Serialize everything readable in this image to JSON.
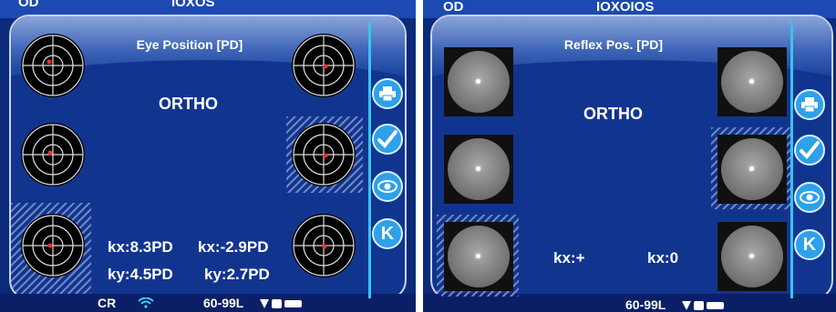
{
  "left": {
    "topbar": {
      "eye_left": "OD",
      "eye_right": "IOXOS"
    },
    "dialog_title": "Eye Position [PD]",
    "status": "ORTHO",
    "measurements": {
      "kx_left": "kx:8.3PD",
      "kx_right": "kx:-2.9PD",
      "ky_left": "ky:4.5PD",
      "ky_right": "ky:2.7PD"
    },
    "bottombar": {
      "mode": "CR",
      "range": "60-99L"
    }
  },
  "right": {
    "topbar": {
      "eye_left": "OD",
      "eye_right": "IOXOIOS"
    },
    "dialog_title": "Reflex Pos. [PD]",
    "status": "ORTHO",
    "measurements": {
      "kx_left": "kx:+",
      "kx_right": "kx:0"
    },
    "bottombar": {
      "range": "60-99L"
    }
  },
  "side_buttons": [
    "print-icon",
    "check-icon",
    "eye-icon",
    "k-icon"
  ],
  "side_button_k_label": "K",
  "colors": {
    "screen_bg": "#0b2a78",
    "dialog_bg": "#11358f",
    "accent": "#39c3ef",
    "button": "#2ea1ea"
  }
}
